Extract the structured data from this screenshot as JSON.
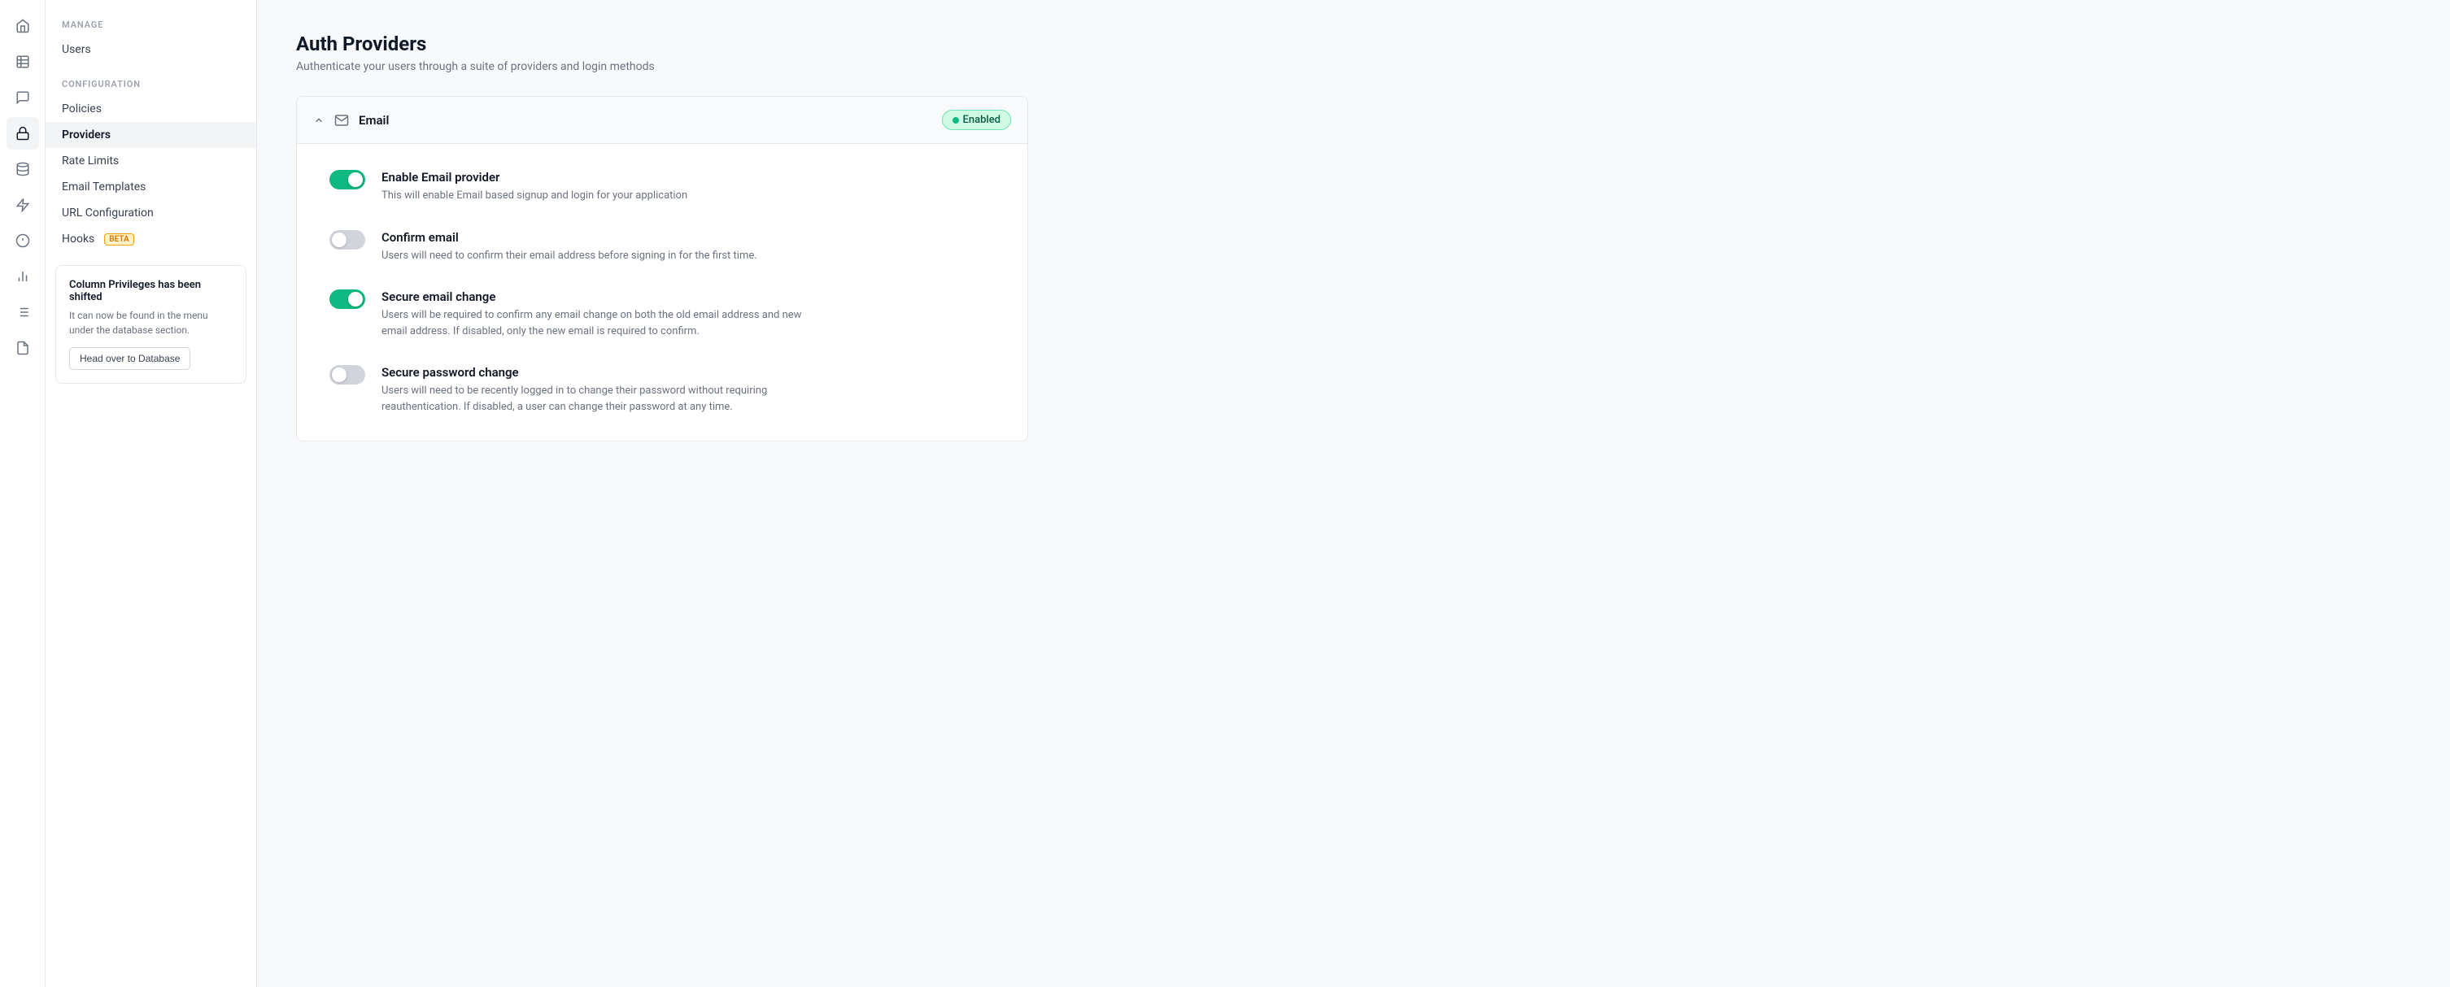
{
  "iconSidebar": {
    "items": [
      {
        "name": "home-icon",
        "glyph": "⌂",
        "active": false
      },
      {
        "name": "table-icon",
        "glyph": "▦",
        "active": false
      },
      {
        "name": "chat-icon",
        "glyph": "💬",
        "active": false
      },
      {
        "name": "shield-icon",
        "glyph": "🔒",
        "active": true
      },
      {
        "name": "storage-icon",
        "glyph": "🗄",
        "active": false
      },
      {
        "name": "functions-icon",
        "glyph": "⚡",
        "active": false
      },
      {
        "name": "bulb-icon",
        "glyph": "💡",
        "active": false
      },
      {
        "name": "chart-icon",
        "glyph": "📊",
        "active": false
      },
      {
        "name": "logs-icon",
        "glyph": "☰",
        "active": false
      },
      {
        "name": "docs-icon",
        "glyph": "📄",
        "active": false
      }
    ]
  },
  "navSidebar": {
    "manageLabel": "MANAGE",
    "configLabel": "CONFIGURATION",
    "manageItems": [
      {
        "label": "Users",
        "active": false
      }
    ],
    "configItems": [
      {
        "label": "Policies",
        "active": false,
        "badge": null
      },
      {
        "label": "Providers",
        "active": true,
        "badge": null
      },
      {
        "label": "Rate Limits",
        "active": false,
        "badge": null
      },
      {
        "label": "Email Templates",
        "active": false,
        "badge": null
      },
      {
        "label": "URL Configuration",
        "active": false,
        "badge": null
      },
      {
        "label": "Hooks",
        "active": false,
        "badge": "BETA"
      }
    ],
    "infoCard": {
      "title": "Column Privileges has been shifted",
      "body": "It can now be found in the menu under the database section.",
      "buttonLabel": "Head over to Database"
    }
  },
  "main": {
    "pageTitle": "Auth Providers",
    "pageSubtitle": "Authenticate your users through a suite of providers and login methods",
    "provider": {
      "name": "Email",
      "enabledLabel": "Enabled",
      "settings": [
        {
          "id": "enable-email",
          "label": "Enable Email provider",
          "description": "This will enable Email based signup and login for your application",
          "on": true
        },
        {
          "id": "confirm-email",
          "label": "Confirm email",
          "description": "Users will need to confirm their email address before signing in for the first time.",
          "on": false
        },
        {
          "id": "secure-email-change",
          "label": "Secure email change",
          "description": "Users will be required to confirm any email change on both the old email address and new email address. If disabled, only the new email is required to confirm.",
          "on": true
        },
        {
          "id": "secure-password-change",
          "label": "Secure password change",
          "description": "Users will need to be recently logged in to change their password without requiring reauthentication. If disabled, a user can change their password at any time.",
          "on": false
        }
      ]
    }
  }
}
